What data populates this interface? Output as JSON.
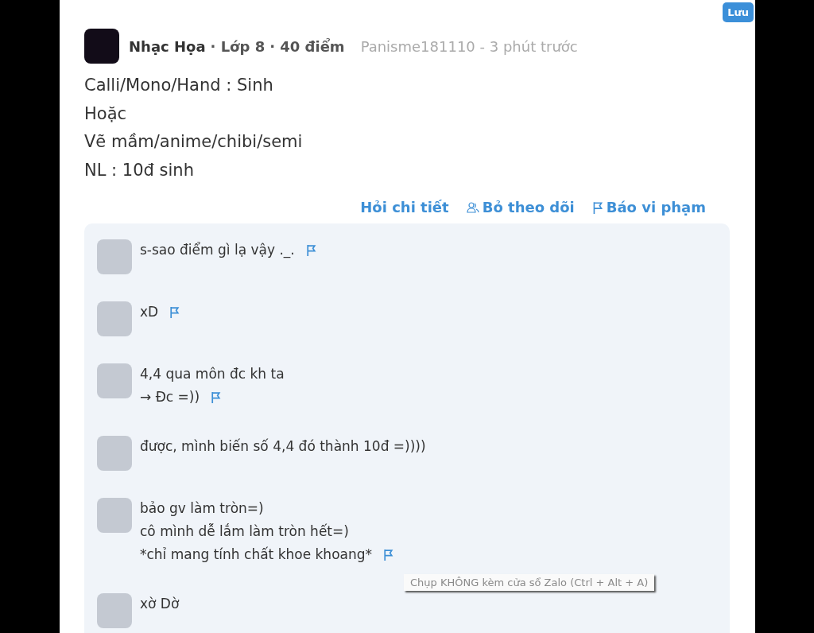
{
  "save_button": "Lưu",
  "post": {
    "subject": "Nhạc Họa",
    "grade": "· Lớp 8",
    "points": "· 40 điểm",
    "author_time": "Panisme181110 - 3 phút trước",
    "lines": [
      "Calli/Mono/Hand : Sinh",
      "Hoặc",
      "Vẽ mầm/anime/chibi/semi",
      "NL : 10đ sinh"
    ]
  },
  "actions": [
    {
      "kind": "ask",
      "label": "Hỏi chi tiết"
    },
    {
      "kind": "unfollow",
      "label": "Bỏ theo dõi"
    },
    {
      "kind": "report",
      "label": "Báo vi phạm"
    }
  ],
  "comments": [
    {
      "lines": [
        "s-sao điểm gì lạ vậy ._."
      ],
      "flag": true
    },
    {
      "lines": [
        "xD"
      ],
      "flag": true
    },
    {
      "lines": [
        "4,4 qua môn đc kh ta",
        "→  Đc =))"
      ],
      "flag": true
    },
    {
      "lines": [
        "được, mình biến số 4,4 đó thành 10đ =))))"
      ],
      "flag": false
    },
    {
      "lines": [
        "bảo gv làm tròn=)",
        "cô mình dễ lắm làm tròn hết=)",
        "*chỉ mang tính chất khoe khoang*"
      ],
      "flag": true
    },
    {
      "lines": [
        "xờ Dờ"
      ],
      "flag": false
    }
  ],
  "tooltip": "Chụp KHÔNG kèm cửa sổ Zalo (Ctrl + Alt + A)"
}
